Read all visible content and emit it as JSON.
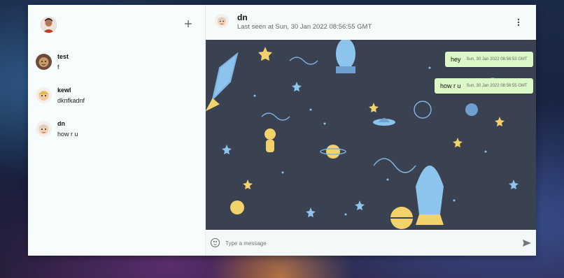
{
  "sidebar": {
    "add_icon": "plus-icon",
    "chats": [
      {
        "name": "test",
        "last_message": "f"
      },
      {
        "name": "kewl",
        "last_message": "dknfkadnf"
      },
      {
        "name": "dn",
        "last_message": "how r u"
      }
    ]
  },
  "chat": {
    "title": "dn",
    "last_seen": "Last seen at Sun, 30 Jan 2022 08:56:55 GMT",
    "messages": [
      {
        "text": "hey",
        "timestamp": "Sun, 30 Jan 2022 08:56:53 GMT"
      },
      {
        "text": "how r u",
        "timestamp": "Sun, 30 Jan 2022 08:56:55 GMT"
      }
    ]
  },
  "composer": {
    "placeholder": "Type a message"
  },
  "colors": {
    "bubble": "#dcf8c6",
    "panel": "#f6fcfc",
    "chat_bg": "#3a4150"
  }
}
